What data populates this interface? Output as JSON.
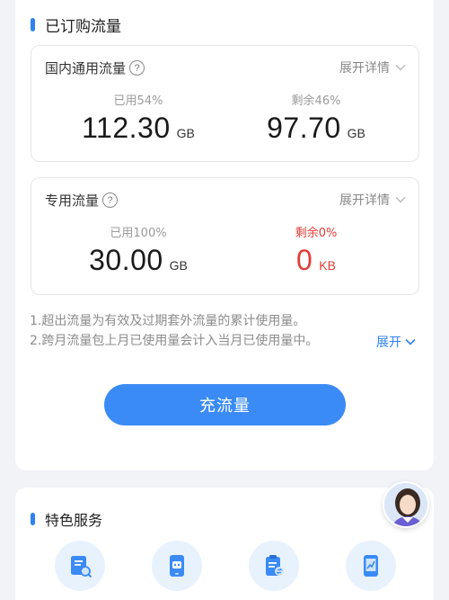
{
  "subscribed": {
    "title": "已订购流量",
    "packages": [
      {
        "name": "国内通用流量",
        "expand_label": "展开详情",
        "used_label": "已用54%",
        "used_value": "112.30",
        "used_unit": "GB",
        "remain_label": "剩余46%",
        "remain_value": "97.70",
        "remain_unit": "GB"
      },
      {
        "name": "专用流量",
        "expand_label": "展开详情",
        "used_label": "已用100%",
        "used_value": "30.00",
        "used_unit": "GB",
        "remain_label": "剩余0%",
        "remain_value": "0",
        "remain_unit": "KB"
      }
    ],
    "help_glyph": "?",
    "notes": [
      "1.超出流量为有效及过期套外流量的累计使用量。",
      "2.跨月流量包上月已使用量会计入当月已使用量中。"
    ],
    "notes_expand_label": "展开",
    "recharge_label": "充流量"
  },
  "services": {
    "title": "特色服务",
    "icons": [
      "doc-search-icon",
      "robot-phone-icon",
      "clipboard-transfer-icon",
      "phone-chart-icon"
    ]
  },
  "colors": {
    "accent": "#3a8bf5",
    "warning": "#e23c36",
    "background": "#f2f3f7"
  }
}
